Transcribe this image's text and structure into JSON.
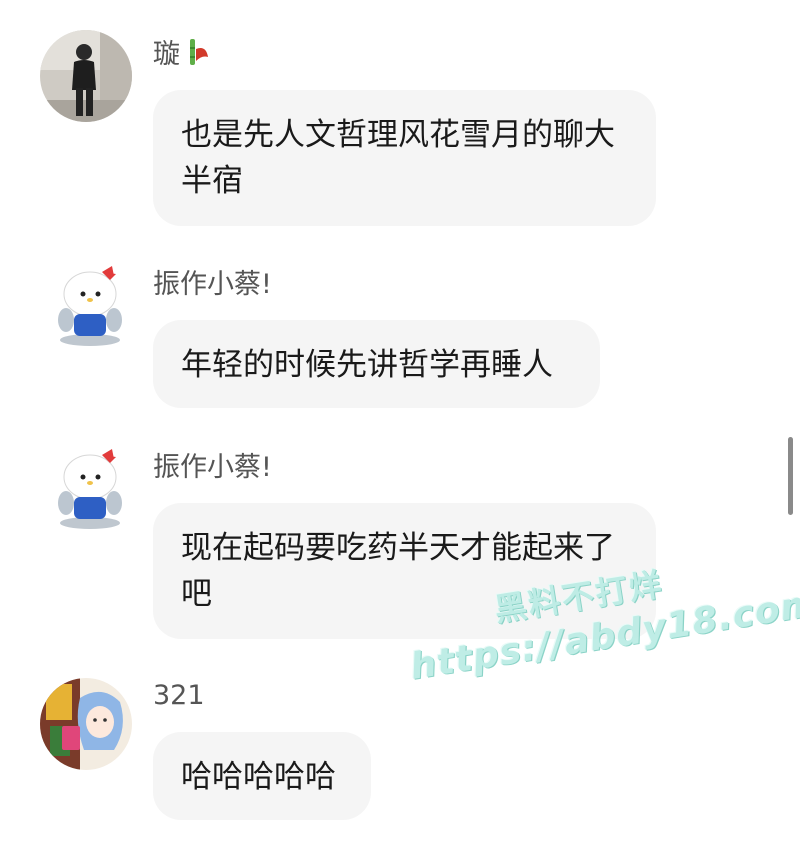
{
  "messages": [
    {
      "name": "璇",
      "text": "也是先人文哲理风花雪月的聊大半宿"
    },
    {
      "name": "振作小蔡!",
      "text": "年轻的时候先讲哲学再睡人"
    },
    {
      "name": "振作小蔡!",
      "text": "现在起码要吃药半天才能起来了吧"
    },
    {
      "name": "321",
      "text": "哈哈哈哈哈"
    }
  ],
  "watermark": {
    "line1": "黑料不打烊",
    "line2": "https://abdy18.com"
  },
  "colors": {
    "bubble": "#f5f5f5",
    "name_text": "#555555",
    "watermark": "#b9ece4"
  }
}
